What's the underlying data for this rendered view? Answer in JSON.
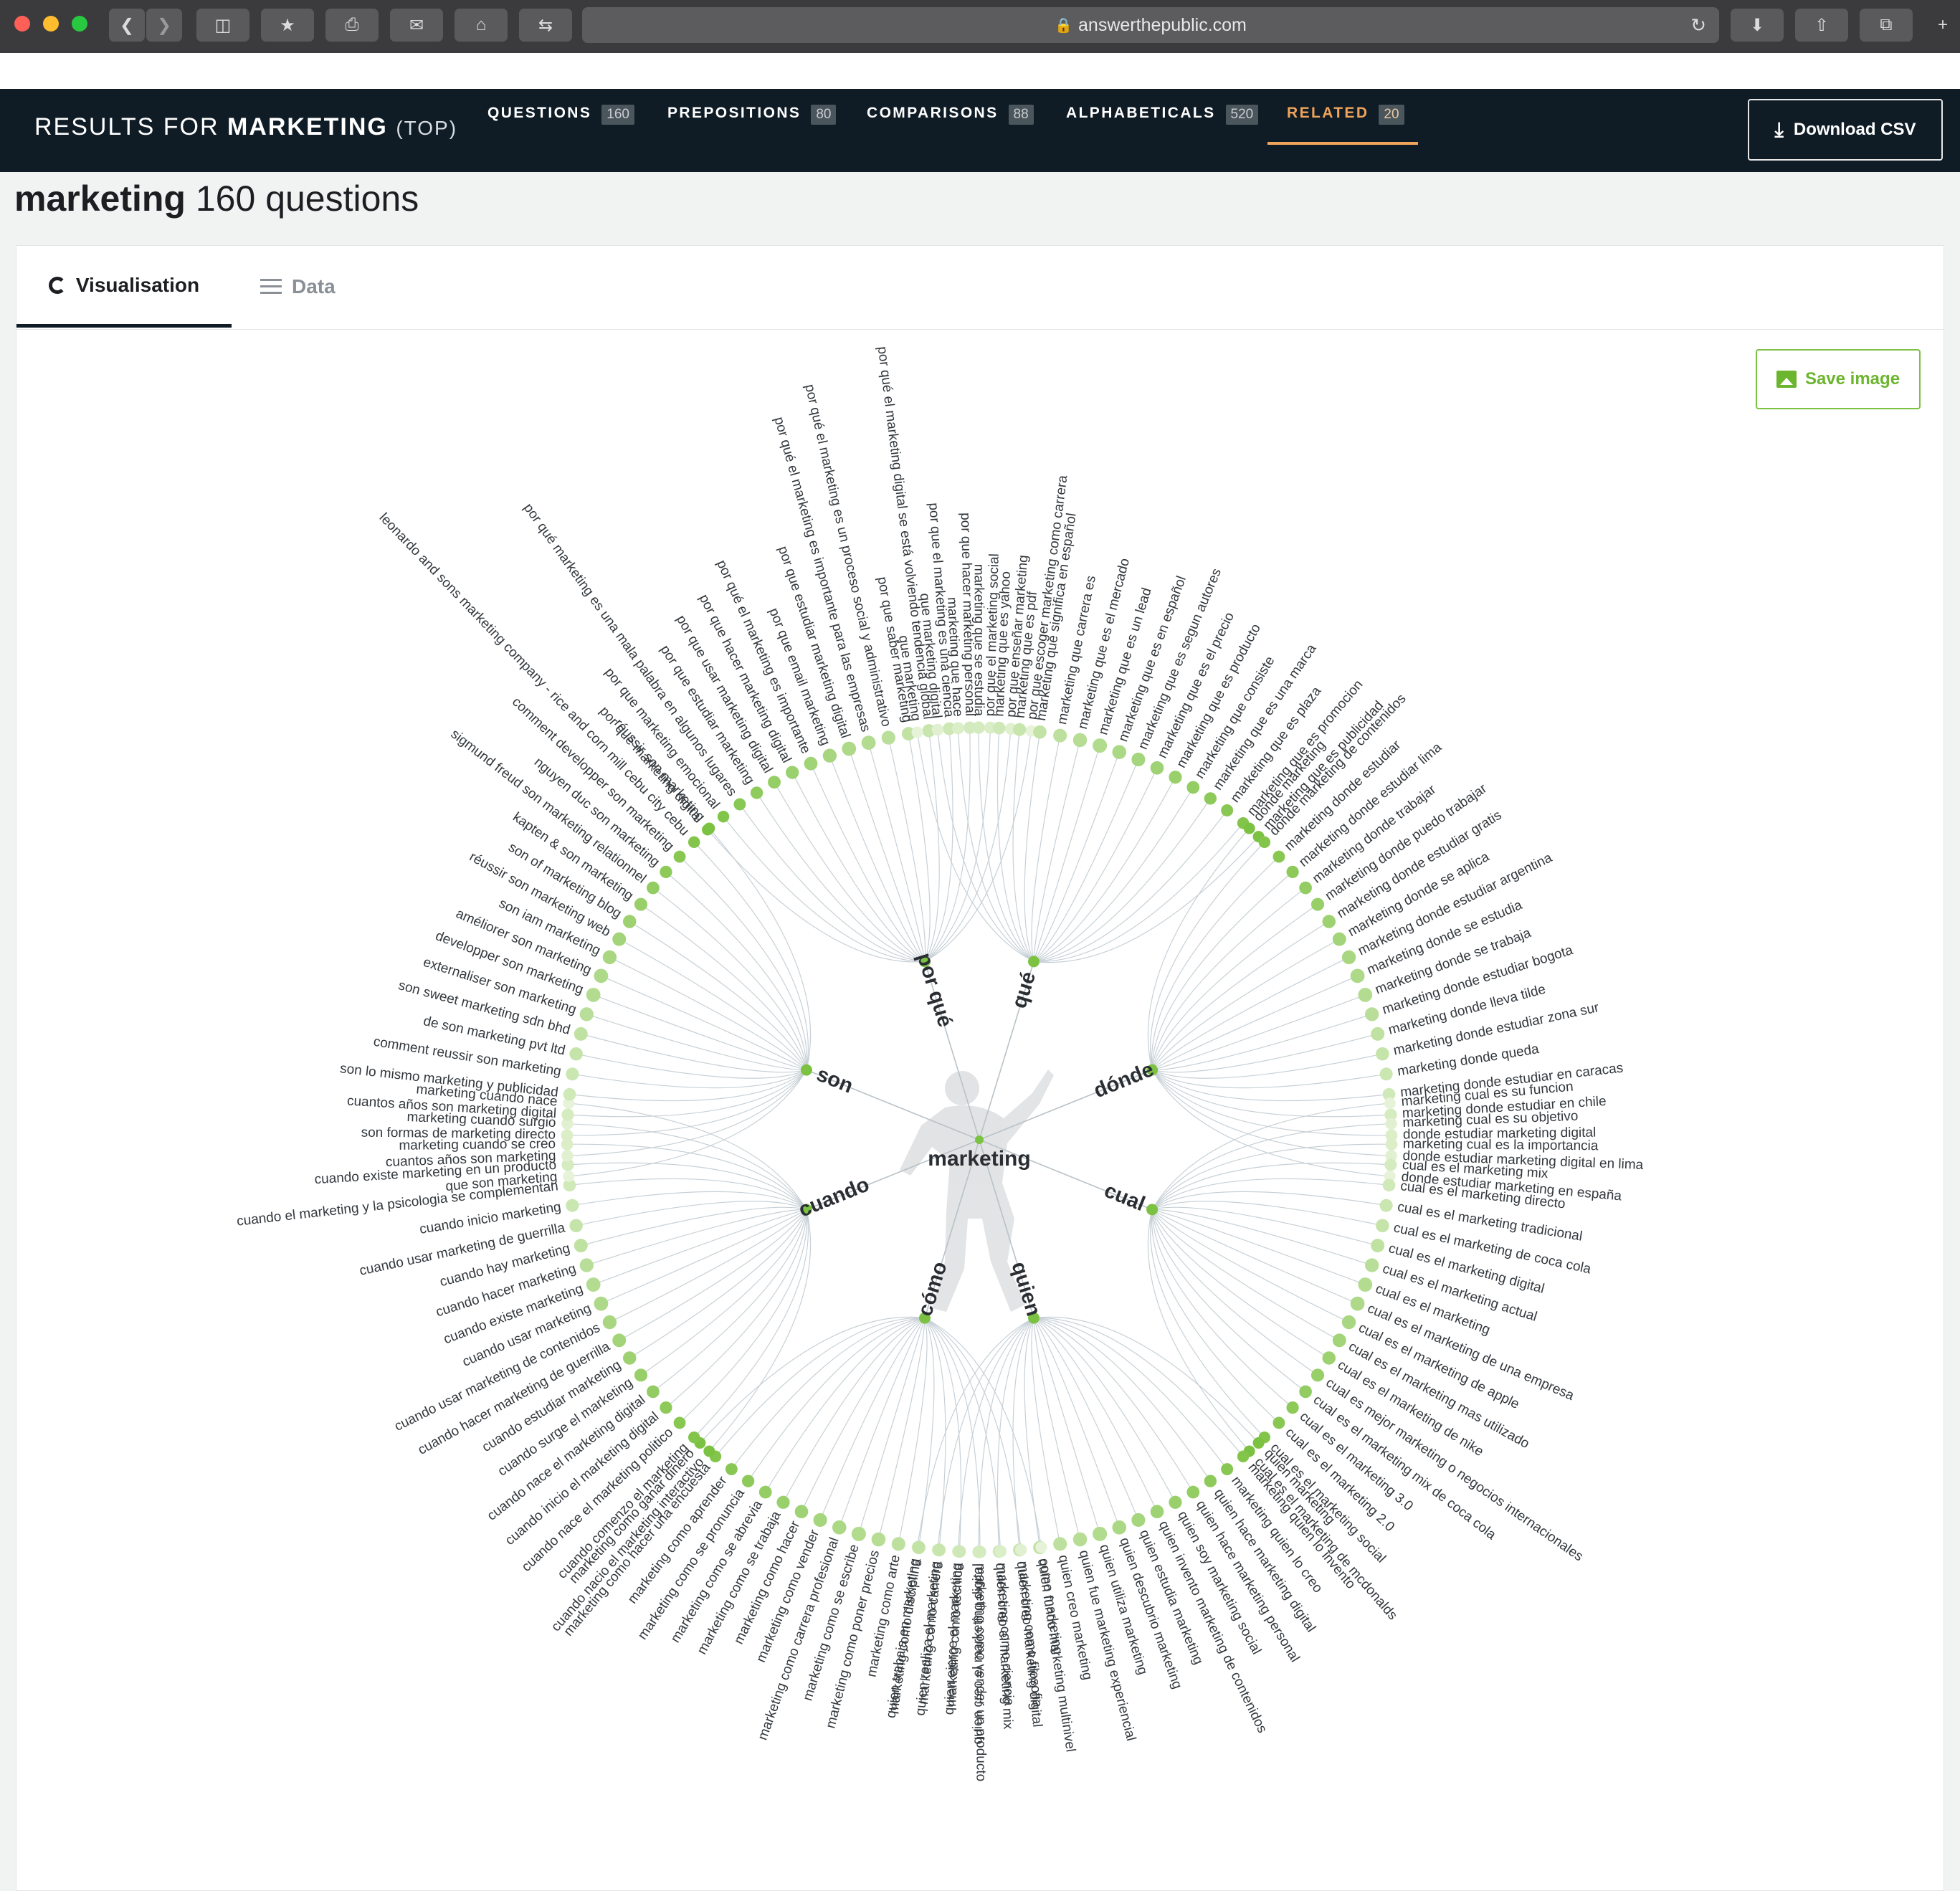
{
  "browser": {
    "url": "answerthepublic.com"
  },
  "header": {
    "results_prefix": "RESULTS FOR",
    "keyword": "MARKETING",
    "scope": "(TOP)",
    "tabs": [
      {
        "label": "QUESTIONS",
        "count": "160"
      },
      {
        "label": "PREPOSITIONS",
        "count": "80"
      },
      {
        "label": "COMPARISONS",
        "count": "88"
      },
      {
        "label": "ALPHABETICALS",
        "count": "520"
      },
      {
        "label": "RELATED",
        "count": "20"
      }
    ],
    "download_label": "Download CSV"
  },
  "page": {
    "keyword": "marketing",
    "count_label": "160 questions"
  },
  "view_tabs": {
    "visualisation": "Visualisation",
    "data": "Data"
  },
  "save_image_label": "Save image",
  "colors": {
    "brand_dark": "#0f1c26",
    "accent_orange": "#f0a35a",
    "node_green": "#7cc242",
    "node_light": "#e6f3d8",
    "link_gray": "#c7d0d6"
  },
  "visualisation": {
    "center_label": "marketing",
    "branches": [
      {
        "label": "por qué",
        "leaves": [
          "por qué marketing digital",
          "por que marketing emocional",
          "por qué marketing es una mala palabra en algunos lugares",
          "por que estudiar marketing",
          "por que usar marketing digital",
          "por que hacer marketing digital",
          "por qué el marketing es importante",
          "por que email marketing",
          "por que estudiar marketing digital",
          "por qué el marketing es importante para las empresas",
          "por qué el marketing es un proceso social y administrativo",
          "por que saber marketing",
          "por qué el marketing digital se está volviendo tendencia global",
          "por que el marketing es una ciencia",
          "por que hacer marketing personal",
          "por que el marketing social",
          "por que enseñar marketing",
          "por que escoger marketing como carrera"
        ]
      },
      {
        "label": "qué",
        "leaves": [
          "que marketing",
          "que marketing digital",
          "marketing que hace",
          "marketing que se estudia",
          "marketing que es yahoo",
          "marketing que es pdf",
          "marketing que significa en español",
          "marketing que carrera es",
          "marketing que es el mercado",
          "marketing que es un lead",
          "marketing que es en español",
          "marketing que es segun autores",
          "marketing que es el precio",
          "marketing que es producto",
          "marketing que consiste",
          "marketing que es una marca",
          "marketing que es plaza",
          "marketing que es promocion",
          "marketing que es publicidad"
        ]
      },
      {
        "label": "dónde",
        "leaves": [
          "donde marketing",
          "donde marketing de contenidos",
          "marketing donde estudiar",
          "marketing donde estudiar lima",
          "marketing donde trabajar",
          "marketing donde puedo trabajar",
          "marketing donde estudiar gratis",
          "marketing donde se aplica",
          "marketing donde estudiar argentina",
          "marketing donde se estudia",
          "marketing donde se trabaja",
          "marketing donde estudiar bogota",
          "marketing donde lleva tilde",
          "marketing donde estudiar zona sur",
          "marketing donde queda",
          "marketing donde estudiar en caracas",
          "marketing donde estudiar en chile",
          "donde estudiar marketing digital",
          "donde estudiar marketing digital en lima",
          "donde estudiar marketing en españa"
        ]
      },
      {
        "label": "cual",
        "leaves": [
          "marketing cual es su funcion",
          "marketing cual es su objetivo",
          "marketing cual es la importancia",
          "cual es el marketing mix",
          "cual es el marketing directo",
          "cual es el marketing tradicional",
          "cual es el marketing de coca cola",
          "cual es el marketing digital",
          "cual es el marketing actual",
          "cual es el marketing",
          "cual es el marketing de una empresa",
          "cual es el marketing de apple",
          "cual es el marketing mas utilizado",
          "cual es el marketing de nike",
          "cual es mejor marketing o negocios internacionales",
          "cual es el marketing mix de coca cola",
          "cual es el marketing 3.0",
          "cual es el marketing 2.0",
          "cual es el marketing social",
          "cual es el marketing de mcdonalds"
        ]
      },
      {
        "label": "quien",
        "leaves": [
          "quien marketing",
          "marketing quien lo invento",
          "marketing quien lo creo",
          "quien hace marketing digital",
          "quien hace marketing personal",
          "quien soy marketing social",
          "quien invento marketing de contenidos",
          "quien estudia marketing",
          "quien descubrio marketing",
          "quien utiliza marketing",
          "quien fue marketing experiencial",
          "quien creo marketing",
          "quien fundo marketing multinivel",
          "quien creo marketing digital",
          "quien creo el marketing mix",
          "quien creo el marketing digital",
          "quien ejerce el marketing",
          "quien realiza el marketing",
          "quien trabaja en marketing"
        ]
      },
      {
        "label": "cómo",
        "leaves": [
          "como marketing",
          "marketing como filosofia",
          "marketing como ciencia",
          "marketing como vender un producto",
          "marketing como tecnica",
          "marketing como carrera",
          "marketing como disciplina",
          "marketing como arte",
          "marketing como poner precios",
          "marketing como se escribe",
          "marketing como carrera profesional",
          "marketing como vender",
          "marketing como hacer",
          "marketing como se trabaja",
          "marketing como se abrevia",
          "marketing como se pronuncia",
          "marketing como aprender",
          "marketing como hacer una encuesta",
          "marketing como ganar dinero"
        ]
      },
      {
        "label": "cuando",
        "leaves": [
          "cuando nacio el marketing interactivo",
          "cuando comenzo el marketing",
          "cuando nace el marketing politico",
          "cuando inicio el marketing digital",
          "cuando nace el marketing digital",
          "cuando surge el marketing",
          "cuando estudiar marketing",
          "cuando hacer marketing de guerrilla",
          "cuando usar marketing de contenidos",
          "cuando usar marketing",
          "cuando existe marketing",
          "cuando hacer marketing",
          "cuando hay marketing",
          "cuando usar marketing de guerrilla",
          "cuando inicio marketing",
          "cuando el marketing y la psicologia se complementan",
          "cuando existe marketing en un producto",
          "marketing cuando se creo",
          "marketing cuando surgio",
          "marketing cuando nace"
        ]
      },
      {
        "label": "son",
        "leaves": [
          "que son marketing",
          "cuantos años son marketing",
          "son formas de marketing directo",
          "cuantos años son marketing digital",
          "son lo mismo marketing y publicidad",
          "comment reussir son marketing",
          "de son marketing pvt ltd",
          "son sweet marketing sdn bhd",
          "externaliser son marketing",
          "developper son marketing",
          "améliorer son marketing",
          "son iam marketing",
          "réussir son marketing web",
          "son of marketing blog",
          "kapten & son marketing",
          "sigmund freud son marketing relationnel",
          "nguyen duc son marketing",
          "comment developper son marketing",
          "leonardo and sons marketing company - rice and corn mill cebu city cebu",
          "réussir son marketing"
        ]
      }
    ]
  }
}
